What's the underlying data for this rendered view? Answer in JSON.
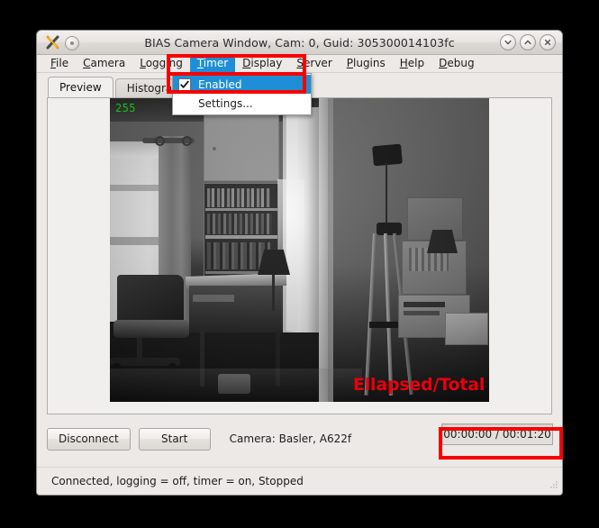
{
  "window": {
    "title": "BIAS Camera Window, Cam: 0, Guid: 305300014103fc",
    "app_icon": "scissors-x-icon",
    "controls": {
      "minimize": "chevron-down-icon",
      "maximize": "chevron-up-icon",
      "close": "close-x-icon"
    }
  },
  "menubar": {
    "items": [
      {
        "label": "File",
        "mnemonic": "F",
        "active": false
      },
      {
        "label": "Camera",
        "mnemonic": "C",
        "active": false
      },
      {
        "label": "Logging",
        "mnemonic": "L",
        "active": false
      },
      {
        "label": "Timer",
        "mnemonic": "T",
        "active": true
      },
      {
        "label": "Display",
        "mnemonic": "D",
        "active": false
      },
      {
        "label": "Server",
        "mnemonic": "S",
        "active": false
      },
      {
        "label": "Plugins",
        "mnemonic": "P",
        "active": false
      },
      {
        "label": "Help",
        "mnemonic": "H",
        "active": false
      },
      {
        "label": "Debug",
        "mnemonic": "D",
        "active": false
      }
    ]
  },
  "timer_menu": {
    "enabled_label": "Enabled",
    "enabled_checked": true,
    "settings_label": "Settings..."
  },
  "tabs": [
    {
      "label": "Preview",
      "selected": true
    },
    {
      "label": "Histogram",
      "selected": false
    }
  ],
  "preview": {
    "overlay_value": "255",
    "annotation_text": "Ellapsed/Total Time"
  },
  "controls": {
    "disconnect_label": "Disconnect",
    "start_label": "Start",
    "camera_label": "Camera:  Basler,  A622f",
    "time_value": "00:00:00 / 00:01:20"
  },
  "statusbar": {
    "text": "Connected, logging = off, timer = on, Stopped"
  },
  "colors": {
    "annotation_red": "#f60000",
    "menu_highlight_blue": "#1e8fd6",
    "overlay_green": "#16c116",
    "window_bg": "#ece9e6",
    "desktop_bg": "#000000"
  }
}
